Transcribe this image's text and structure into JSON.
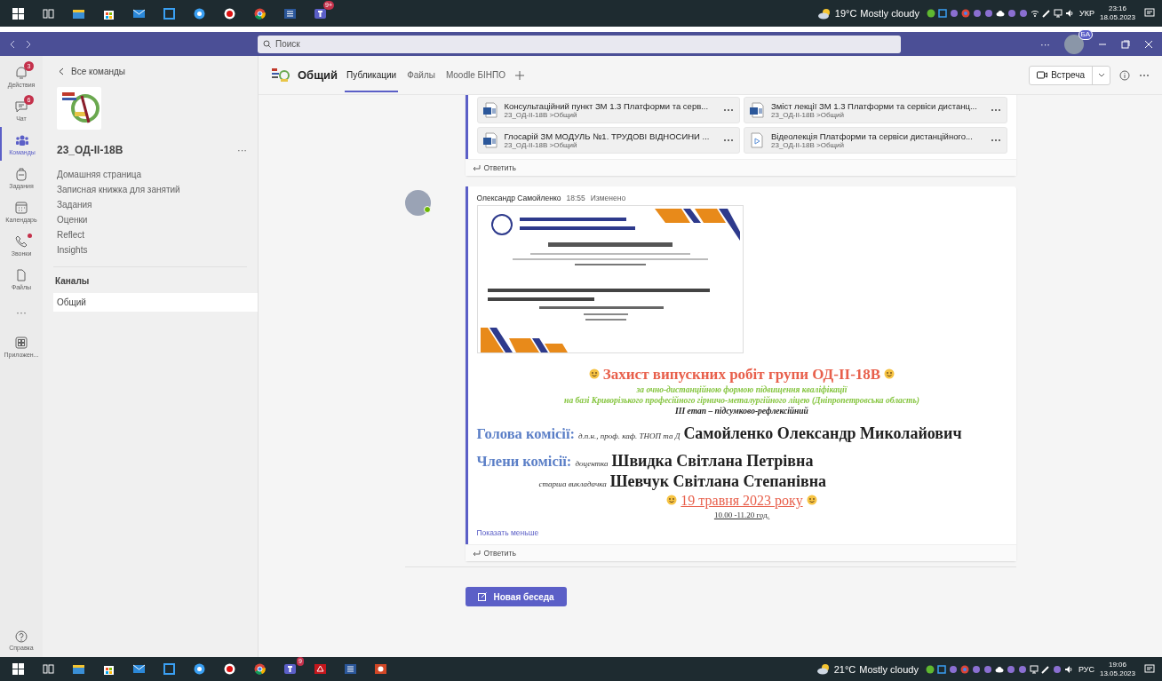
{
  "taskbar_top": {
    "apps": [
      {
        "kind": "windows"
      },
      {
        "kind": "taskview"
      },
      {
        "kind": "folder"
      },
      {
        "kind": "store"
      },
      {
        "kind": "mail"
      },
      {
        "kind": "snip"
      },
      {
        "kind": "bluecircle"
      },
      {
        "kind": "record"
      },
      {
        "kind": "chrome"
      },
      {
        "kind": "word"
      },
      {
        "kind": "teams",
        "badge": "9+"
      }
    ],
    "weather": {
      "temp": "19°C",
      "text": "Mostly cloudy"
    },
    "tray": [
      {
        "kind": "shield"
      },
      {
        "kind": "snip"
      },
      {
        "kind": "app"
      },
      {
        "kind": "chrome"
      },
      {
        "kind": "app"
      },
      {
        "kind": "app"
      },
      {
        "kind": "cloud"
      },
      {
        "kind": "app"
      },
      {
        "kind": "app"
      },
      {
        "kind": "wifi"
      },
      {
        "kind": "pen"
      },
      {
        "kind": "network"
      },
      {
        "kind": "volume"
      }
    ],
    "language": "УКР",
    "time": "23:16",
    "date": "18.05.2023"
  },
  "title_bar": {
    "search_placeholder": "Поиск",
    "more": "···",
    "avatar_badge": "БА"
  },
  "app_bar": {
    "items": [
      {
        "kind": "bell",
        "label": "Действия",
        "badge": "3",
        "selected": false,
        "alert": false
      },
      {
        "kind": "chat",
        "label": "Чат",
        "badge": "6",
        "selected": false,
        "alert": false
      },
      {
        "kind": "team",
        "label": "Команды",
        "selected": true,
        "alert": false
      },
      {
        "kind": "bag",
        "label": "Задания",
        "selected": false,
        "alert": false
      },
      {
        "kind": "calendar",
        "label": "Календарь",
        "selected": false,
        "alert": false
      },
      {
        "kind": "phone",
        "label": "Звонки",
        "selected": false,
        "alert": true
      },
      {
        "kind": "file",
        "label": "Файлы",
        "selected": false,
        "alert": false
      },
      {
        "kind": "more",
        "label": "···",
        "selected": false,
        "alert": false
      },
      {
        "kind": "apps",
        "label": "Приложен...",
        "selected": false,
        "alert": false
      }
    ],
    "help": {
      "label": "Справка"
    }
  },
  "sidebar": {
    "back": "Все команды",
    "team_name": "23_ОД-II-18В",
    "team_more": "···",
    "nav": [
      "Домашняя страница",
      "Записная книжка для занятий",
      "Задания",
      "Оценки",
      "Reflect",
      "Insights"
    ],
    "channels_heading": "Каналы",
    "channels": [
      {
        "name": "Общий",
        "selected": true
      }
    ]
  },
  "channel_header": {
    "title": "Общий",
    "tabs": [
      {
        "label": "Публикации",
        "selected": true
      },
      {
        "label": "Файлы",
        "selected": false
      },
      {
        "label": "Moodle БІНПО",
        "selected": false
      }
    ],
    "meet": "Встреча"
  },
  "feed": {
    "posts": [
      {
        "kind": "files",
        "files": [
          {
            "kind": "word",
            "name": "Консультаційний пункт ЗМ 1.3 Платформи та серв...",
            "path": "23_ОД-II-18В >Общий"
          },
          {
            "kind": "word",
            "name": "Зміст лекції ЗМ 1.3 Платформи та сервіси дистанц...",
            "path": "23_ОД-II-18В >Общий"
          },
          {
            "kind": "word",
            "name": "Глосарій ЗМ МОДУЛЬ №1. ТРУДОВІ ВІДНОСИНИ ...",
            "path": "23_ОД-II-18В >Общий"
          },
          {
            "kind": "video",
            "name": "Відеолекція Платформи та сервіси дистанційного...",
            "path": "23_ОД-II-18В >Общий"
          }
        ],
        "reply": "Ответить"
      },
      {
        "kind": "message",
        "author": "Олександр Самойленко",
        "time": "18:55",
        "edited": "Изменено",
        "lines": [
          {
            "kind": "center",
            "segments": [
              {
                "kind": "emoji"
              },
              {
                "kind": "title",
                "text": "Захист випускних робіт групи ОД-II-18В"
              },
              {
                "kind": "emoji"
              }
            ]
          },
          {
            "kind": "center",
            "segments": [
              {
                "kind": "green",
                "text": "за очно-дистанційною формою підвищення кваліфікації"
              }
            ]
          },
          {
            "kind": "center",
            "segments": [
              {
                "kind": "green",
                "text": "на базі Криворізького професійного гірничо-металургійного ліцею (Дніпропетровська область)"
              }
            ]
          },
          {
            "kind": "center",
            "segments": [
              {
                "kind": "stage",
                "text": "ІІІ етап – підсумково-рефлексійний"
              }
            ]
          },
          {
            "kind": "left",
            "segments": [
              {
                "kind": "label",
                "text": "Голова комісії:"
              },
              {
                "kind": "role",
                "text": "д.п.н., проф. каф. ТНОП та Д"
              },
              {
                "kind": "name",
                "text": "Самойленко Олександр Миколайович"
              }
            ]
          },
          {
            "kind": "left",
            "segments": [
              {
                "kind": "label",
                "text": "Члени комісії:"
              },
              {
                "kind": "role",
                "text": "доцентка"
              },
              {
                "kind": "name",
                "text": "Швидка Світлана Петрівна"
              }
            ]
          },
          {
            "kind": "indent",
            "segments": [
              {
                "kind": "role",
                "text": "старша викладачка"
              },
              {
                "kind": "name",
                "text": "Шевчук Світлана Степанівна"
              }
            ]
          },
          {
            "kind": "center",
            "segments": [
              {
                "kind": "emoji"
              },
              {
                "kind": "date",
                "text": "19 травня  2023  року"
              },
              {
                "kind": "emoji"
              }
            ]
          },
          {
            "kind": "center",
            "segments": [
              {
                "kind": "time",
                "text": "10.00 -11.20 год."
              }
            ]
          }
        ],
        "show_less": "Показать меньше",
        "reply": "Ответить"
      }
    ]
  },
  "new_conversation": "Новая беседа",
  "taskbar_bottom": {
    "apps": [
      {
        "kind": "windows"
      },
      {
        "kind": "taskview"
      },
      {
        "kind": "folder"
      },
      {
        "kind": "store"
      },
      {
        "kind": "mail"
      },
      {
        "kind": "snip"
      },
      {
        "kind": "bluecircle"
      },
      {
        "kind": "record"
      },
      {
        "kind": "chrome"
      },
      {
        "kind": "teams",
        "badge": "9"
      },
      {
        "kind": "pdf"
      },
      {
        "kind": "word"
      },
      {
        "kind": "ppt"
      }
    ],
    "weather": {
      "temp": "21°C",
      "text": "Mostly cloudy"
    },
    "tray": [
      {
        "kind": "shield"
      },
      {
        "kind": "snip"
      },
      {
        "kind": "app"
      },
      {
        "kind": "chrome"
      },
      {
        "kind": "app"
      },
      {
        "kind": "app"
      },
      {
        "kind": "cloud"
      },
      {
        "kind": "app"
      },
      {
        "kind": "app"
      },
      {
        "kind": "network"
      },
      {
        "kind": "pen"
      },
      {
        "kind": "app"
      },
      {
        "kind": "volume"
      }
    ],
    "language": "РУС",
    "time": "19:06",
    "date": "13.05.2023"
  }
}
